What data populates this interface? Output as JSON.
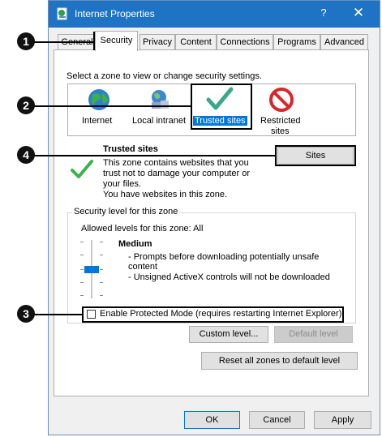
{
  "window": {
    "title": "Internet Properties",
    "help": "?",
    "close": "✕"
  },
  "tabs": [
    "General",
    "Security",
    "Privacy",
    "Content",
    "Connections",
    "Programs",
    "Advanced"
  ],
  "zone_prompt": "Select a zone to view or change security settings.",
  "zones": [
    {
      "line1": "Internet",
      "line2": "",
      "icon": "globe-icon"
    },
    {
      "line1": "Local intranet",
      "line2": "",
      "icon": "intranet-icon"
    },
    {
      "line1": "Trusted sites",
      "line2": "",
      "icon": "trusted-checkmark-icon"
    },
    {
      "line1": "Restricted",
      "line2": "sites",
      "icon": "restricted-icon"
    }
  ],
  "zone_info": {
    "title": "Trusted sites",
    "line1": "This zone contains websites that you",
    "line2": "trust not to damage your computer or",
    "line3": "your files.",
    "line4": "You have websites in this zone.",
    "sites_button": "Sites"
  },
  "security_level": {
    "legend": "Security level for this zone",
    "allowed": "Allowed levels for this zone: All",
    "level_name": "Medium",
    "bullet1a": "- Prompts before downloading potentially unsafe",
    "bullet1b": "content",
    "bullet2": "- Unsigned ActiveX controls will not be downloaded"
  },
  "protected_mode": {
    "label": "Enable Protected Mode (requires restarting Internet Explorer)",
    "checked": false
  },
  "buttons": {
    "custom_level": "Custom level...",
    "default_level": "Default level",
    "reset_all": "Reset all zones to default level",
    "ok": "OK",
    "cancel": "Cancel",
    "apply": "Apply"
  },
  "callouts": [
    "1",
    "2",
    "3",
    "4"
  ],
  "colors": {
    "titlebar": "#1e73c4",
    "selection": "#0078d7",
    "checkmark": "#3aa88a",
    "restricted": "#d9262b"
  }
}
